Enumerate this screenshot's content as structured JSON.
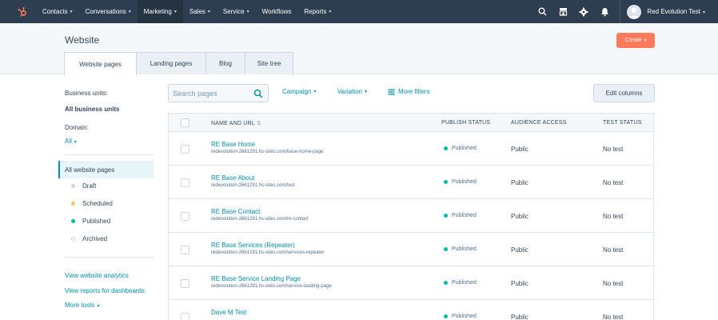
{
  "colors": {
    "nav_bg": "#2d3e50",
    "accent": "#0091ae",
    "create": "#ff7a59",
    "draft": "#cbd6e2",
    "scheduled": "#f5c26b",
    "published": "#00bda5"
  },
  "nav": {
    "logo": "hubspot-sprocket-icon",
    "items": [
      {
        "label": "Contacts",
        "caret": "▾"
      },
      {
        "label": "Conversations",
        "caret": "▾"
      },
      {
        "label": "Marketing",
        "caret": "▾"
      },
      {
        "label": "Sales",
        "caret": "▾"
      },
      {
        "label": "Service",
        "caret": "▾"
      },
      {
        "label": "Workflows",
        "caret": ""
      },
      {
        "label": "Reports",
        "caret": "▾"
      }
    ],
    "account": "Red Evolution Test",
    "account_caret": "▾"
  },
  "header": {
    "title": "Website",
    "create_label": "Create",
    "create_caret": "▾",
    "tabs": [
      "Website pages",
      "Landing pages",
      "Blog",
      "Site tree"
    ]
  },
  "sidebar": {
    "business_units_label": "Business units:",
    "business_units_value": "All business units",
    "domain_label": "Domain:",
    "domain_value": "All",
    "domain_caret": "▾",
    "active_filter": "All website pages",
    "statuses": [
      {
        "label": "Draft"
      },
      {
        "label": "Scheduled"
      },
      {
        "label": "Published"
      },
      {
        "label": "Archived"
      }
    ],
    "links": [
      "View website analytics",
      "View reports for dashboards",
      "More tools"
    ],
    "more_caret": "▾"
  },
  "toolbar": {
    "search_placeholder": "Search pages",
    "campaign": "Campaign",
    "variation": "Variation",
    "more_filters": "More filters",
    "edit_columns": "Edit columns",
    "caret": "▾"
  },
  "table": {
    "headers": {
      "name": "NAME AND URL",
      "sort": "⇅",
      "publish": "PUBLISH STATUS",
      "audience": "AUDIENCE ACCESS",
      "test": "TEST STATUS"
    },
    "rows": [
      {
        "name": "RE Base Home",
        "url": "redevolution-2661291.hs-sites.com/base-home-page",
        "status": "Published",
        "access": "Public",
        "test": "No test"
      },
      {
        "name": "RE Base About",
        "url": "redevolution-2661291.hs-sites.com/test",
        "status": "Published",
        "access": "Public",
        "test": "No test"
      },
      {
        "name": "RE Base Contact",
        "url": "redevolution-2661291.hs-sites.com/re-contact",
        "status": "Published",
        "access": "Public",
        "test": "No test"
      },
      {
        "name": "RE Base Services (Repeater)",
        "url": "redevolution-2661291.hs-sites.com/services-repeater",
        "status": "Published",
        "access": "Public",
        "test": "No test"
      },
      {
        "name": "RE Base Service Landing Page",
        "url": "redevolution-2661291.hs-sites.com/service-landing-page",
        "status": "Published",
        "access": "Public",
        "test": "No test"
      },
      {
        "name": "Dave M Test",
        "url": "",
        "status": "Published",
        "access": "Public",
        "test": "No test"
      }
    ]
  }
}
